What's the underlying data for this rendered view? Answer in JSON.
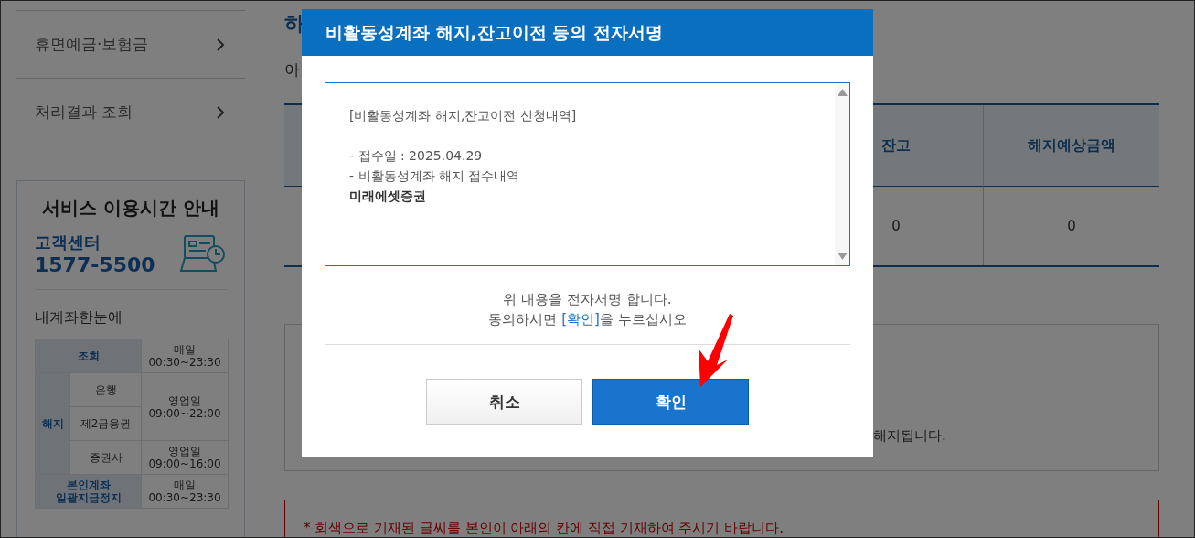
{
  "sidebar": {
    "items": [
      {
        "label": "휴면예금·보험금"
      },
      {
        "label": "처리결과 조회"
      }
    ]
  },
  "service_hours": {
    "title": "서비스 이용시간 안내",
    "center_label": "고객센터",
    "phone": "1577-5500",
    "section_title": "내계좌한눈에",
    "schedule": {
      "inquiry": {
        "label": "조회",
        "time": [
          "매일",
          "00:30~23:30"
        ]
      },
      "termination": {
        "label": "해지",
        "items": [
          "은행",
          "제2금융권",
          "증권사"
        ],
        "times": [
          [
            "영업일",
            "09:00~22:00"
          ],
          [
            "영업일",
            "09:00~16:00"
          ]
        ]
      },
      "suspension": {
        "label": [
          "본인계좌",
          "일괄지급정지"
        ],
        "time": [
          "매일",
          "00:30~23:30"
        ]
      }
    }
  },
  "main": {
    "heading": "하",
    "subheading": "아",
    "table": {
      "columns": [
        "잔고",
        "해지예상금액"
      ],
      "rows": [
        [
          "0",
          "0"
        ]
      ]
    },
    "notice": "해지됩니다.",
    "warning": "* 회색으로 기재된 글씨를 본인이 아래의 칸에 직접 기재하여 주시기 바랍니다."
  },
  "dialog": {
    "title": "비활동성계좌 해지,잔고이전 등의 전자서명",
    "content": [
      {
        "kind": "heading",
        "text": "[비활동성계좌 해지,잔고이전 신청내역]"
      },
      {
        "kind": "item",
        "text": "- 접수일 : 2025.04.29"
      },
      {
        "kind": "item",
        "text": "- 비활동성계좌 해지 접수내역"
      },
      {
        "kind": "strong",
        "text": "미래에셋증권"
      }
    ],
    "message": {
      "line1": "위 내용을 전자서명 합니다.",
      "before": "동의하시면 ",
      "highlight": "[확인]",
      "after": "을 누르십시오"
    },
    "buttons": [
      {
        "label": "취소",
        "kind": "secondary"
      },
      {
        "label": "확인",
        "kind": "primary"
      }
    ]
  }
}
